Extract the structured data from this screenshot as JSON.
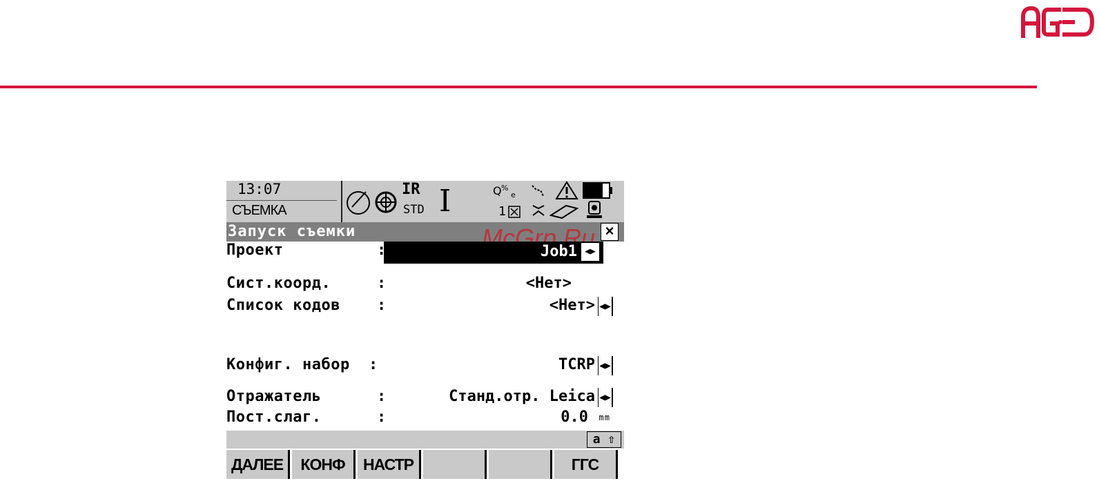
{
  "brand": {
    "logo_text": "AGED",
    "accent_color": "#d4163c"
  },
  "status_bar": {
    "time": "13:07",
    "mode": "СЪЕМКА",
    "edm_mode": "IR",
    "edm_sub": "STD",
    "cursor": "I",
    "count": "1",
    "icons": [
      "compass-icon",
      "prism-icon",
      "atr-icon",
      "line-icon",
      "warning-icon",
      "battery-icon",
      "points-icon",
      "card-icon",
      "instrument-icon"
    ]
  },
  "title": "Запуск съемки",
  "watermark": "McGrp.Ru",
  "fields": {
    "project": {
      "label": "Проект",
      "value": "Job1"
    },
    "coord_system": {
      "label": "Сист.коорд.",
      "value": "<Нет>"
    },
    "code_list": {
      "label": "Список кодов",
      "value": "<Нет>"
    },
    "config_set": {
      "label": "Конфиг. набор",
      "value": "TCRP"
    },
    "reflector": {
      "label": "Отражатель",
      "value": "Станд.отр. Leica"
    },
    "add_const": {
      "label": "Пост.слаг.",
      "value": "0.0",
      "unit": "mm"
    }
  },
  "case_indicator": "a ⇧",
  "fkeys": [
    {
      "label": "ДАЛЕЕ"
    },
    {
      "label": "КОНФ"
    },
    {
      "label": "НАСТР"
    },
    {
      "label": ""
    },
    {
      "label": ""
    },
    {
      "label": "ГГС"
    }
  ]
}
